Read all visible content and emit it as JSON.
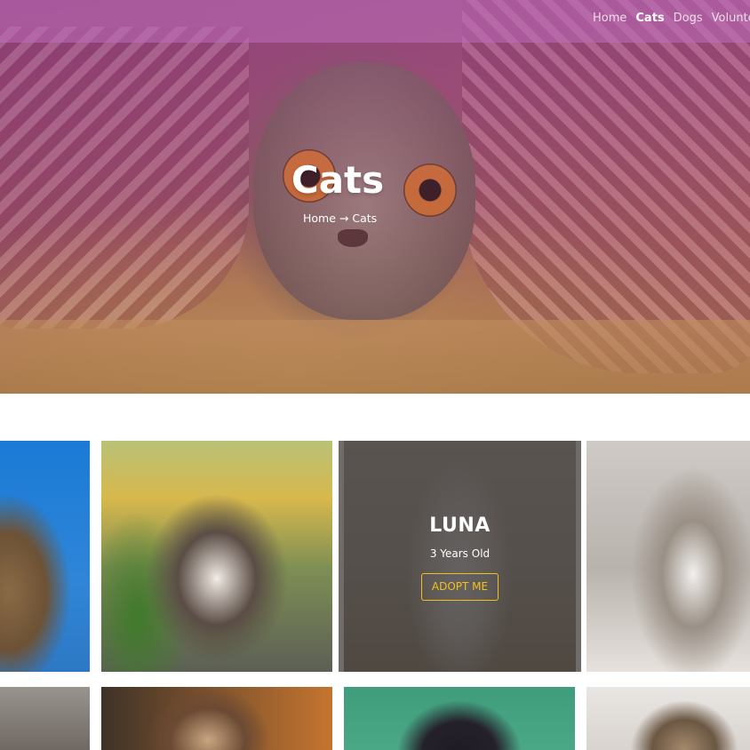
{
  "nav": {
    "links": [
      {
        "label": "Home",
        "active": false
      },
      {
        "label": "Cats",
        "active": true
      },
      {
        "label": "Dogs",
        "active": false
      },
      {
        "label": "Volunte",
        "active": false
      }
    ]
  },
  "hero": {
    "title": "Cats",
    "breadcrumb": {
      "home": "Home",
      "separator": "→",
      "current": "Cats"
    }
  },
  "featured_card": {
    "name": "LUNA",
    "age": "3 Years Old",
    "button_label": "ADOPT ME"
  },
  "colors": {
    "nav_overlay": "#be6eb9",
    "button_accent": "#f1c21b",
    "card_overlay": "#282422"
  }
}
